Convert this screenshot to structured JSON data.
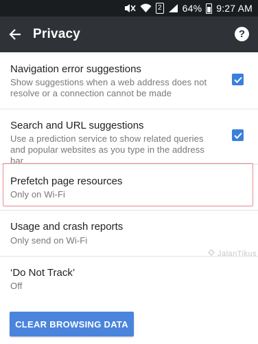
{
  "status_bar": {
    "battery": "64%",
    "time": "9:27 AM",
    "sim": "2",
    "icons": [
      "mute-icon",
      "wifi-icon",
      "sim-icon",
      "signal-icon",
      "battery-icon"
    ]
  },
  "app_bar": {
    "title": "Privacy",
    "back_icon": "arrow-back-icon",
    "help_icon": "help-icon",
    "help_glyph": "?"
  },
  "settings": [
    {
      "title": "Navigation error suggestions",
      "summary": "Show suggestions when a web address does not resolve or a connection cannot be made",
      "checked": true
    },
    {
      "title": "Search and URL suggestions",
      "summary": "Use a prediction service to show related queries and popular websites as you type in the address bar",
      "checked": true
    },
    {
      "title": "Prefetch page resources",
      "summary": "Only on Wi-Fi",
      "highlighted": true
    },
    {
      "title": "Usage and crash reports",
      "summary": "Only send on Wi-Fi"
    },
    {
      "title": "‘Do Not Track’",
      "summary": "Off"
    }
  ],
  "clear_button": {
    "label": "CLEAR BROWSING DATA"
  },
  "watermark": {
    "text": "JalanTikus"
  },
  "colors": {
    "accent": "#3a7fdc",
    "app_bar": "#2f3237",
    "status_bar": "#1a1d20",
    "highlight": "#e98a96",
    "button": "#4a84dc"
  }
}
